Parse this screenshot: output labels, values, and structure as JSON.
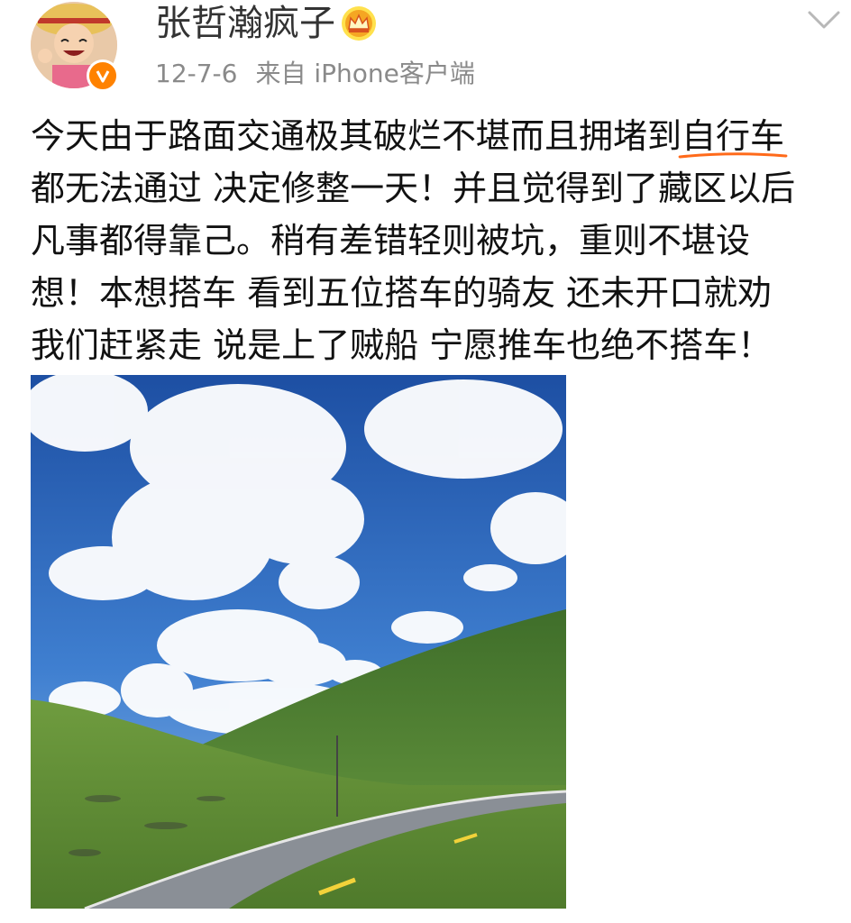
{
  "post": {
    "username": "张哲瀚疯子",
    "date": "12-7-6",
    "source": "来自 iPhone客户端",
    "text_lines": [
      {
        "before": "今天由于路面交通极其破烂不堪而且拥堵到",
        "highlight": "自行车"
      },
      {
        "text": "都无法通过 决定修整一天！并且觉得到了藏区以后"
      },
      {
        "text": "凡事都得靠己。稍有差错轻则被坑，重则不堪设"
      },
      {
        "text": "想！本想搭车 看到五位搭车的骑友 还未开口就劝"
      },
      {
        "text": "我们赶紧走 说是上了贼船 宁愿推车也绝不搭车！"
      }
    ],
    "annotation_color": "#ff6a1a",
    "badge_color": "#ff8200",
    "crown_color": "#f5a623"
  },
  "icons": {
    "avatar": "avatar",
    "verified": "verified-badge",
    "crown": "crown-icon",
    "menu": "chevron-down-icon"
  }
}
